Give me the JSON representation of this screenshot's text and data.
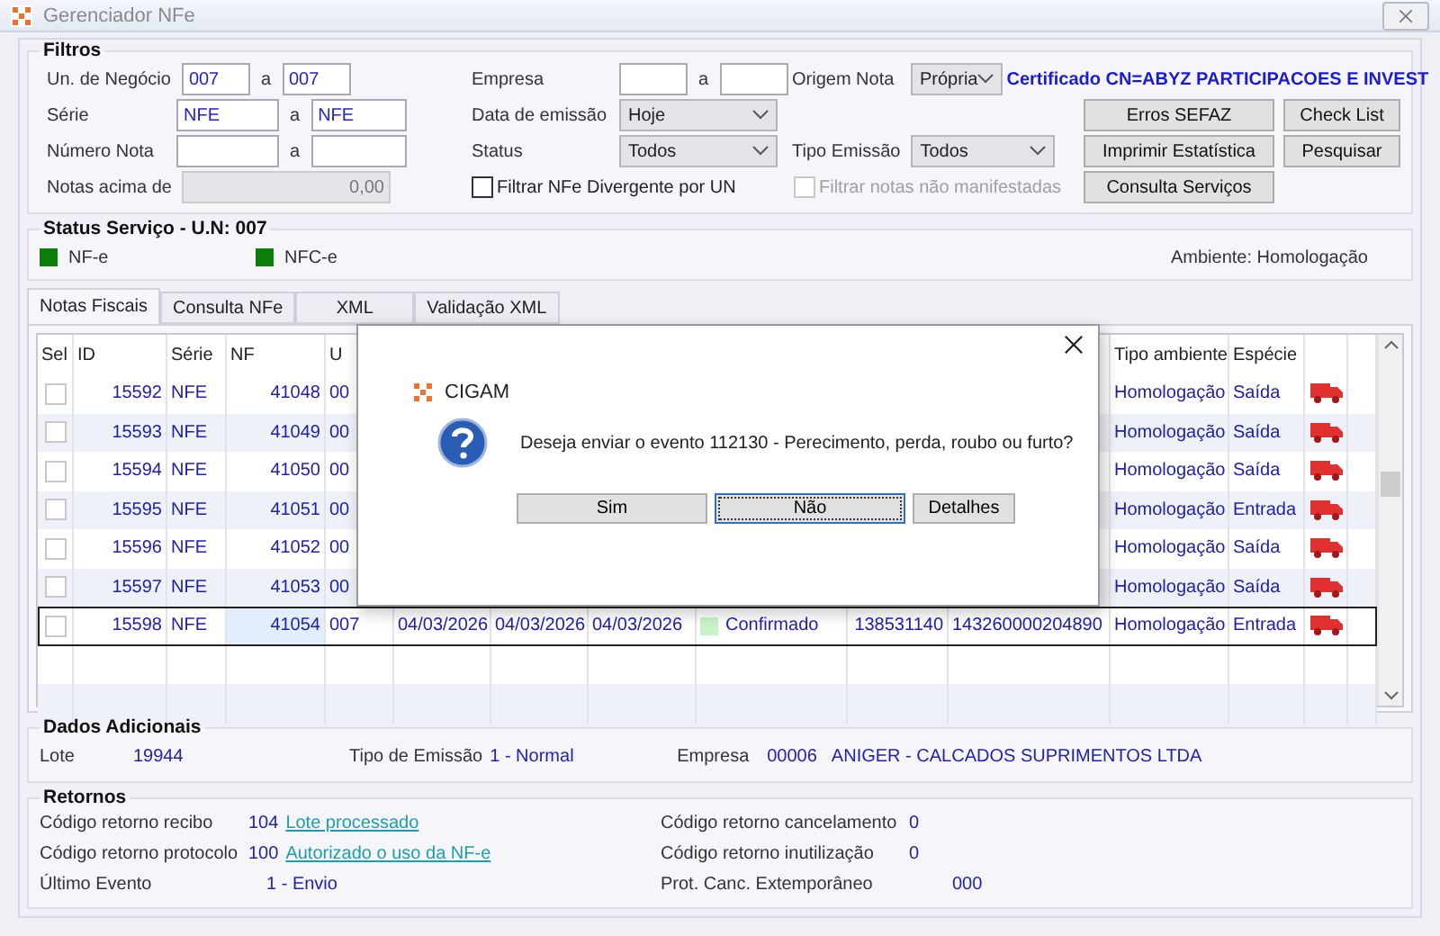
{
  "window": {
    "title": "Gerenciador NFe"
  },
  "filters": {
    "title": "Filtros",
    "left": [
      {
        "kind": "range",
        "label": "Un. de Negócio",
        "from": "007",
        "to": "007",
        "separator": "a",
        "narrow": true
      },
      {
        "kind": "range",
        "label": "Série",
        "from": "NFE",
        "to": "NFE",
        "separator": "a",
        "narrow": false
      },
      {
        "kind": "range",
        "label": "Número Nota",
        "separator": "a",
        "narrow": false
      },
      {
        "kind": "single",
        "label": "Notas acima de",
        "value": "0,00",
        "disabled": true
      }
    ],
    "middle": [
      {
        "kind": "range",
        "label": "Empresa",
        "separator": "a",
        "narrow": true
      },
      {
        "kind": "select",
        "label": "Data de emissão",
        "value": "Hoje"
      },
      {
        "kind": "select",
        "label": "Status",
        "value": "Todos"
      },
      {
        "kind": "checkbox",
        "label": "Filtrar NFe Divergente por UN",
        "checked": false,
        "disabled": false
      }
    ],
    "origem": {
      "label": "Origem Nota",
      "value": "Própria"
    },
    "certificate": "Certificado CN=ABYZ PARTICIPACOES E INVEST",
    "tipo_emissao": {
      "label": "Tipo Emissão",
      "value": "Todos"
    },
    "manifest_checkbox": {
      "label": "Filtrar notas não manifestadas",
      "checked": false,
      "disabled": true
    },
    "buttons": [
      {
        "label": "Erros SEFAZ"
      },
      {
        "label": "Check List"
      },
      {
        "label": "Imprimir Estatística"
      },
      {
        "label": "Pesquisar"
      },
      {
        "label": "Consulta Serviços"
      }
    ]
  },
  "service_status": {
    "title": "Status Serviço - U.N: 007",
    "services": [
      {
        "label": "NF-e",
        "color": "#0a7d0a"
      },
      {
        "label": "NFC-e",
        "color": "#0a7d0a"
      }
    ],
    "environment": "Ambiente: Homologação"
  },
  "tabs": [
    {
      "label": "Notas Fiscais",
      "selected": true
    },
    {
      "label": "Consulta NFe",
      "selected": false
    },
    {
      "label": "XML",
      "selected": false
    },
    {
      "label": "Validação XML",
      "selected": false
    }
  ],
  "table": {
    "headers": {
      "sel": "Sel",
      "id": "ID",
      "serie": "Série",
      "nf": "NF",
      "un": "U",
      "tipo_ambiente": "Tipo ambiente",
      "especie": "Espécie"
    },
    "rows": [
      {
        "checked": false,
        "selected": false,
        "id": "15592",
        "serie": "NFE",
        "nf": "41048",
        "un": "00",
        "tipo_ambiente": "Homologação",
        "especie": "Saída"
      },
      {
        "checked": false,
        "selected": false,
        "id": "15593",
        "serie": "NFE",
        "nf": "41049",
        "un": "00",
        "tipo_ambiente": "Homologação",
        "especie": "Saída"
      },
      {
        "checked": false,
        "selected": false,
        "id": "15594",
        "serie": "NFE",
        "nf": "41050",
        "un": "00",
        "tipo_ambiente": "Homologação",
        "especie": "Saída"
      },
      {
        "checked": false,
        "selected": false,
        "id": "15595",
        "serie": "NFE",
        "nf": "41051",
        "un": "00",
        "tipo_ambiente": "Homologação",
        "especie": "Entrada"
      },
      {
        "checked": false,
        "selected": false,
        "id": "15596",
        "serie": "NFE",
        "nf": "41052",
        "un": "00",
        "tipo_ambiente": "Homologação",
        "especie": "Saída"
      },
      {
        "checked": false,
        "selected": false,
        "id": "15597",
        "serie": "NFE",
        "nf": "41053",
        "un": "00",
        "tipo_ambiente": "Homologação",
        "especie": "Saída"
      },
      {
        "checked": false,
        "selected": true,
        "id": "15598",
        "serie": "NFE",
        "nf": "41054",
        "un": "007",
        "date_1": "04/03/2026",
        "date_2": "04/03/2026",
        "date_3": "04/03/2026",
        "status": "Confirmado",
        "color": "#c8f3c8",
        "column_10": "138531140",
        "column_11": "143260000204890",
        "tipo_ambiente": "Homologação",
        "especie": "Entrada"
      }
    ]
  },
  "dialog": {
    "title": "CIGAM",
    "message": "Deseja enviar o evento 112130 - Perecimento, perda, roubo ou furto?",
    "buttons": [
      {
        "label": "Sim",
        "focused": false
      },
      {
        "label": "Não",
        "focused": true
      },
      {
        "label": "Detalhes",
        "focused": false
      }
    ]
  },
  "additional": {
    "title": "Dados Adicionais",
    "lote": {
      "label": "Lote",
      "value": "19944"
    },
    "tipo_emissao": {
      "label": "Tipo de Emissão",
      "value": "1 - Normal"
    },
    "empresa": {
      "label": "Empresa",
      "code": "00006",
      "name": "ANIGER - CALCADOS SUPRIMENTOS LTDA"
    }
  },
  "returns": {
    "title": "Retornos",
    "left": [
      {
        "kind": "link",
        "label": "Código retorno recibo",
        "code": "104",
        "link": "Lote processado"
      },
      {
        "kind": "link",
        "label": "Código retorno protocolo",
        "code": "100",
        "link": "Autorizado o uso da NF-e"
      },
      {
        "kind": "text",
        "label": "Último Evento",
        "value": "1 - Envio"
      }
    ],
    "right": [
      {
        "kind": "code",
        "label": "Código retorno cancelamento",
        "value": "0"
      },
      {
        "kind": "code",
        "label": "Código retorno inutilização",
        "value": "0"
      },
      {
        "kind": "text",
        "label": "Prot. Canc. Extemporâneo",
        "value": "000"
      }
    ]
  }
}
